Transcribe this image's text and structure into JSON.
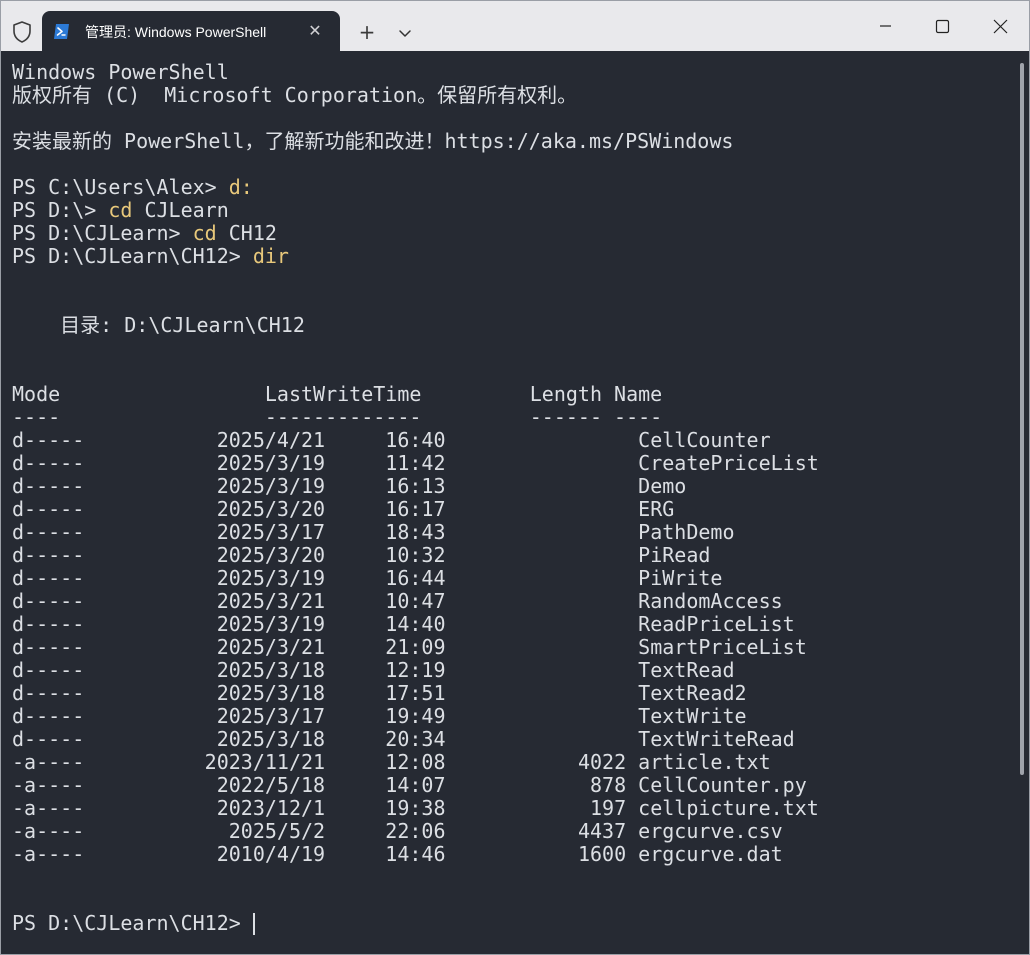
{
  "window": {
    "tab_title": "管理员: Windows PowerShell",
    "new_tab_symbol": "+",
    "close_tab_symbol": "✕"
  },
  "terminal": {
    "header_line1": "Windows PowerShell",
    "header_line2": "版权所有 (C)  Microsoft Corporation。保留所有权利。",
    "promo_line": "安装最新的 PowerShell，了解新功能和改进！https://aka.ms/PSWindows",
    "commands": [
      {
        "prompt": "PS C:\\Users\\Alex> ",
        "cmd": "d:",
        "arg": ""
      },
      {
        "prompt": "PS D:\\> ",
        "cmd": "cd",
        "arg": " CJLearn"
      },
      {
        "prompt": "PS D:\\CJLearn> ",
        "cmd": "cd",
        "arg": " CH12"
      },
      {
        "prompt": "PS D:\\CJLearn\\CH12> ",
        "cmd": "dir",
        "arg": ""
      }
    ],
    "directory_line": "    目录: D:\\CJLearn\\CH12",
    "table_header": "Mode                 LastWriteTime         Length Name",
    "table_separator": "----                 -------------         ------ ----",
    "rows": [
      {
        "mode": "d-----",
        "date": "2025/4/21",
        "time": "16:40",
        "length": "",
        "name": "CellCounter"
      },
      {
        "mode": "d-----",
        "date": "2025/3/19",
        "time": "11:42",
        "length": "",
        "name": "CreatePriceList"
      },
      {
        "mode": "d-----",
        "date": "2025/3/19",
        "time": "16:13",
        "length": "",
        "name": "Demo"
      },
      {
        "mode": "d-----",
        "date": "2025/3/20",
        "time": "16:17",
        "length": "",
        "name": "ERG"
      },
      {
        "mode": "d-----",
        "date": "2025/3/17",
        "time": "18:43",
        "length": "",
        "name": "PathDemo"
      },
      {
        "mode": "d-----",
        "date": "2025/3/20",
        "time": "10:32",
        "length": "",
        "name": "PiRead"
      },
      {
        "mode": "d-----",
        "date": "2025/3/19",
        "time": "16:44",
        "length": "",
        "name": "PiWrite"
      },
      {
        "mode": "d-----",
        "date": "2025/3/21",
        "time": "10:47",
        "length": "",
        "name": "RandomAccess"
      },
      {
        "mode": "d-----",
        "date": "2025/3/19",
        "time": "14:40",
        "length": "",
        "name": "ReadPriceList"
      },
      {
        "mode": "d-----",
        "date": "2025/3/21",
        "time": "21:09",
        "length": "",
        "name": "SmartPriceList"
      },
      {
        "mode": "d-----",
        "date": "2025/3/18",
        "time": "12:19",
        "length": "",
        "name": "TextRead"
      },
      {
        "mode": "d-----",
        "date": "2025/3/18",
        "time": "17:51",
        "length": "",
        "name": "TextRead2"
      },
      {
        "mode": "d-----",
        "date": "2025/3/17",
        "time": "19:49",
        "length": "",
        "name": "TextWrite"
      },
      {
        "mode": "d-----",
        "date": "2025/3/18",
        "time": "20:34",
        "length": "",
        "name": "TextWriteRead"
      },
      {
        "mode": "-a----",
        "date": "2023/11/21",
        "time": "12:08",
        "length": "4022",
        "name": "article.txt"
      },
      {
        "mode": "-a----",
        "date": "2022/5/18",
        "time": "14:07",
        "length": "878",
        "name": "CellCounter.py"
      },
      {
        "mode": "-a----",
        "date": "2023/12/1",
        "time": "19:38",
        "length": "197",
        "name": "cellpicture.txt"
      },
      {
        "mode": "-a----",
        "date": "2025/5/2",
        "time": "22:06",
        "length": "4437",
        "name": "ergcurve.csv"
      },
      {
        "mode": "-a----",
        "date": "2010/4/19",
        "time": "14:46",
        "length": "1600",
        "name": "ergcurve.dat"
      }
    ],
    "final_prompt": "PS D:\\CJLearn\\CH12> "
  },
  "colors": {
    "background": "#262a33",
    "text": "#dcdfe4",
    "command": "#e8c87b",
    "titlebar": "#e9e9ec"
  },
  "icons": {
    "shield": "shield-icon",
    "powershell": "powershell-icon",
    "dropdown": "chevron-down-icon",
    "minimize": "minimize-icon",
    "maximize": "maximize-icon",
    "close": "close-icon"
  }
}
